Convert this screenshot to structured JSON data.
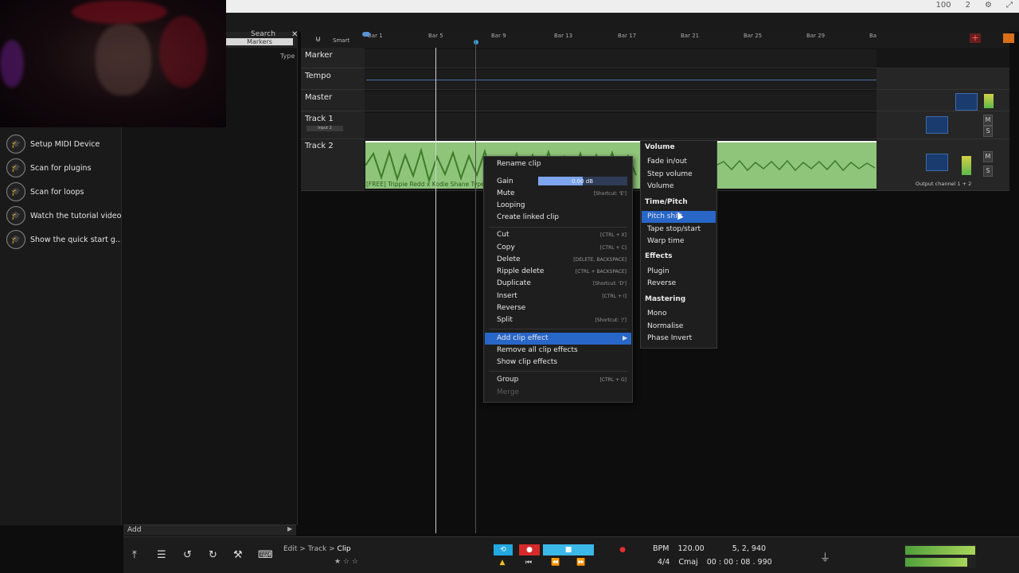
{
  "app": {
    "window_controls": [
      "100",
      "2"
    ]
  },
  "browser": {
    "search_label": "Search",
    "markers_tab": "Markers",
    "type_label": "Type",
    "close": "✕"
  },
  "quickstart": {
    "items": [
      {
        "label": "Setup MIDI Device"
      },
      {
        "label": "Scan for plugins"
      },
      {
        "label": "Scan for loops"
      },
      {
        "label": "Watch the tutorial video"
      },
      {
        "label": "Show the quick start g..."
      }
    ],
    "add_label": "Add"
  },
  "timeline": {
    "smart_label": "Smart",
    "bars": [
      "Bar 1",
      "Bar 5",
      "Bar 9",
      "Bar 13",
      "Bar 17",
      "Bar 21",
      "Bar 25",
      "Bar 29",
      "Ba"
    ]
  },
  "tracks": [
    {
      "name": "Marker"
    },
    {
      "name": "Tempo"
    },
    {
      "name": "Master"
    },
    {
      "name": "Track 1",
      "input": "Input 2"
    },
    {
      "name": "Track 2",
      "clip_label": "[FREE] Trippie Redd x Kodie Shane Type B",
      "output": "Output channel 1 + 2"
    }
  ],
  "context_menu": {
    "rename": "Rename clip",
    "gain": "Gain",
    "gain_value": "0.00 dB",
    "mute": "Mute",
    "mute_sc": "[Shortcut: 'E']",
    "looping": "Looping",
    "create_linked": "Create linked clip",
    "cut": "Cut",
    "cut_sc": "[CTRL + X]",
    "copy": "Copy",
    "copy_sc": "[CTRL + C]",
    "delete": "Delete",
    "delete_sc": "[DELETE, BACKSPACE]",
    "ripple_delete": "Ripple delete",
    "ripple_sc": "[CTRL + BACKSPACE]",
    "duplicate": "Duplicate",
    "duplicate_sc": "[Shortcut: 'D']",
    "insert": "Insert",
    "insert_sc": "[CTRL + I]",
    "reverse": "Reverse",
    "split": "Split",
    "split_sc": "[Shortcut: '/']",
    "add_effect": "Add clip effect",
    "remove_effects": "Remove all clip effects",
    "show_effects": "Show clip effects",
    "group": "Group",
    "group_sc": "[CTRL + G]",
    "merge": "Merge"
  },
  "submenu": {
    "volume_header": "Volume",
    "fade": "Fade in/out",
    "step_volume": "Step volume",
    "volume": "Volume",
    "timepitch_header": "Time/Pitch",
    "pitch_shift": "Pitch shift",
    "tape_stop": "Tape stop/start",
    "warp_time": "Warp time",
    "effects_header": "Effects",
    "plugin": "Plugin",
    "reverse": "Reverse",
    "mastering_header": "Mastering",
    "mono": "Mono",
    "normalise": "Normalise",
    "phase_invert": "Phase Invert"
  },
  "bottom": {
    "breadcrumb": [
      "Edit",
      "Track",
      "Clip"
    ],
    "bpm_label": "BPM",
    "bpm": "120.00",
    "position": "5, 2, 940",
    "time_sig": "4/4",
    "key": "Cmaj",
    "time": "00 : 00 : 08 . 990"
  },
  "mixer": {
    "m": "M",
    "s": "S"
  },
  "colors": {
    "accent": "#2866c8",
    "clip": "#8fc57a",
    "record": "#e03030"
  }
}
